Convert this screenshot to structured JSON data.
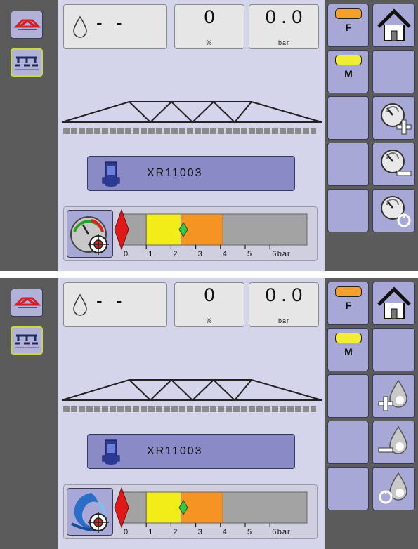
{
  "screens": [
    {
      "main": {
        "flow_value": "- -",
        "rate": {
          "value": "0",
          "unit": "%"
        },
        "pressure": {
          "value": "0 . 0",
          "unit": "bar"
        },
        "nozzle_label": "XR11003",
        "gauge": {
          "unit_label": "bar",
          "ticks": [
            "0",
            "1",
            "2",
            "3",
            "4",
            "5",
            "6"
          ],
          "min": 0,
          "max": 7.5,
          "zones": [
            {
              "from": 0,
              "to": 1,
              "color": "#a3a3a3"
            },
            {
              "from": 1,
              "to": 2.4,
              "color": "#f2ec18"
            },
            {
              "from": 2.4,
              "to": 4.1,
              "color": "#f59422"
            },
            {
              "from": 4.1,
              "to": 7.5,
              "color": "#a3a3a3"
            }
          ],
          "target_value": 2.5,
          "current_value": 0
        }
      },
      "right": {
        "f_label": "F",
        "m_label": "M",
        "f_color": "#f5a02a",
        "m_color": "#f1ec36",
        "adjust_icons": [
          "pressure-increase-icon",
          "pressure-decrease-icon",
          "pressure-reset-icon"
        ]
      }
    },
    {
      "main": {
        "flow_value": "- -",
        "rate": {
          "value": "0",
          "unit": "%"
        },
        "pressure": {
          "value": "0 . 0",
          "unit": "bar"
        },
        "nozzle_label": "XR11003",
        "gauge": {
          "unit_label": "bar",
          "ticks": [
            "0",
            "1",
            "2",
            "3",
            "4",
            "5",
            "6"
          ],
          "min": 0,
          "max": 7.5,
          "zones": [
            {
              "from": 0,
              "to": 1,
              "color": "#a3a3a3"
            },
            {
              "from": 1,
              "to": 2.4,
              "color": "#f2ec18"
            },
            {
              "from": 2.4,
              "to": 4.1,
              "color": "#f59422"
            },
            {
              "from": 4.1,
              "to": 7.5,
              "color": "#a3a3a3"
            }
          ],
          "target_value": 2.5,
          "current_value": 0
        }
      },
      "right": {
        "f_label": "F",
        "m_label": "M",
        "f_color": "#f5a02a",
        "m_color": "#f1ec36",
        "adjust_icons": [
          "rate-increase-icon",
          "rate-decrease-icon",
          "rate-reset-icon"
        ]
      }
    }
  ]
}
